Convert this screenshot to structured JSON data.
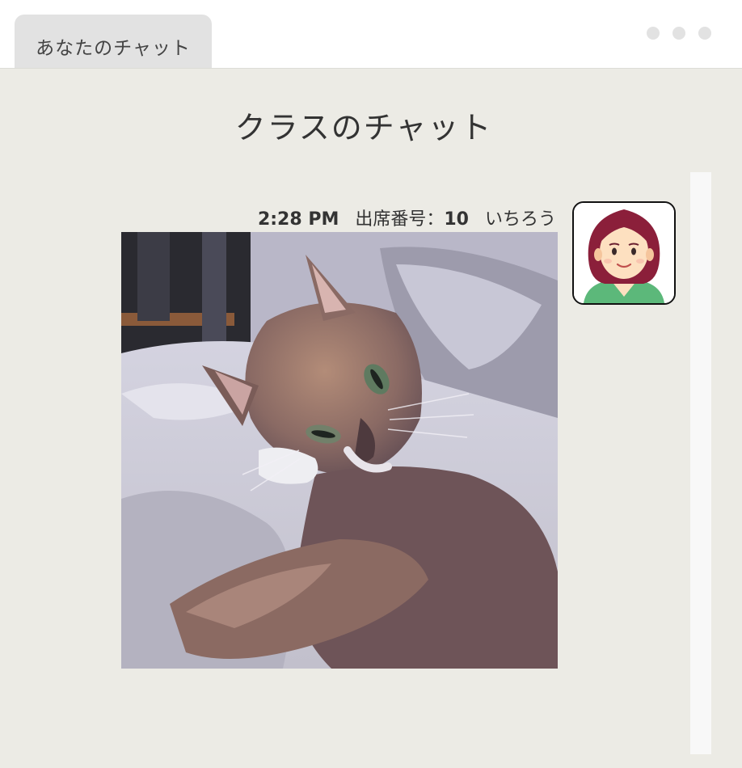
{
  "tab": {
    "label": "あなたのチャット"
  },
  "room": {
    "title": "クラスのチャット"
  },
  "message": {
    "time": "2:28 PM",
    "seat_label": "出席番号：",
    "seat_number": "10",
    "sender": "いちろう",
    "attachment_icon": "cat-photo"
  },
  "colors": {
    "background": "#ecebe5",
    "tab": "#e2e2e2",
    "avatar_hair": "#8b1f3a",
    "avatar_shirt": "#5cb87a"
  }
}
